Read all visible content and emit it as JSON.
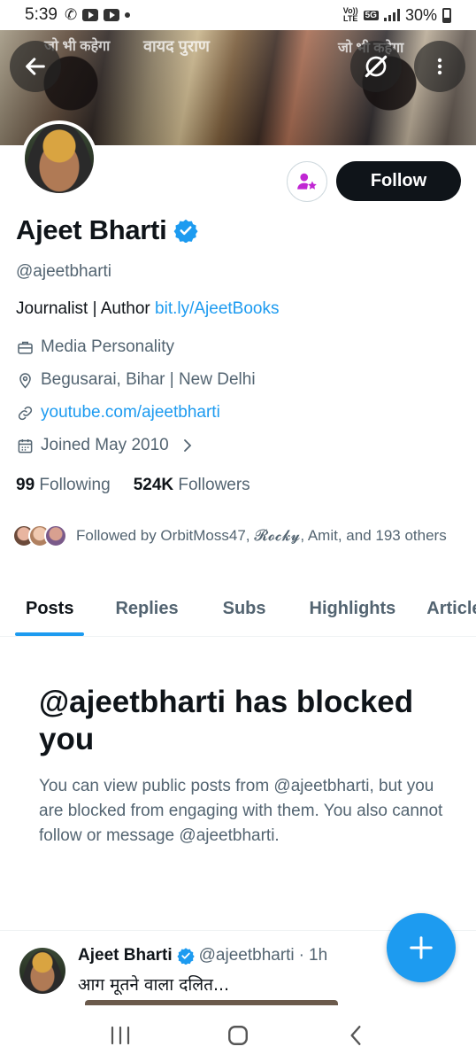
{
  "status_bar": {
    "time": "5:39",
    "volte_top": "Vo))",
    "volte_bottom": "LTE",
    "network": "5G",
    "battery": "30%"
  },
  "banner": {
    "text_left": "जो भी कहेगा",
    "text_mid": "वायद पुराण",
    "text_right": "जो भी कहेगा"
  },
  "profile": {
    "name": "Ajeet Bharti",
    "handle": "@ajeetbharti",
    "bio_text": "Journalist | Author ",
    "bio_link": "bit.ly/AjeetBooks",
    "category": "Media Personality",
    "location": "Begusarai, Bihar | New Delhi",
    "website": "youtube.com/ajeetbharti",
    "joined": "Joined May 2010",
    "following_count": "99",
    "following_label": " Following",
    "followers_count": "524K",
    "followers_label": " Followers",
    "followed_by": "Followed by OrbitMoss47, 𝓡𝓸𝓬𝓴𝔂, Amit, and 193 others",
    "follow_label": "Follow"
  },
  "tabs": [
    {
      "label": "Posts",
      "active": true
    },
    {
      "label": "Replies"
    },
    {
      "label": "Subs"
    },
    {
      "label": "Highlights"
    },
    {
      "label": "Articles"
    }
  ],
  "blocked": {
    "title": "@ajeetbharti has blocked you",
    "body": "You can view public posts from @ajeetbharti, but you are blocked from engaging with them. You also cannot follow or message @ajeetbharti."
  },
  "tweet": {
    "name": "Ajeet Bharti",
    "handle": "@ajeetbharti",
    "separator": "·",
    "time": "1h",
    "text": "आग मूतने वाला दलित..."
  },
  "colors": {
    "accent": "#1d9bf0",
    "text": "#0f1419",
    "muted": "#536471",
    "subscribe_purple": "#c026d3"
  },
  "icons": {
    "back": "back-arrow-icon",
    "grok": "grok-icon",
    "more": "more-vertical-icon",
    "subscribe": "subscribe-star-icon",
    "verified": "verified-badge-icon",
    "briefcase": "briefcase-icon",
    "location": "location-pin-icon",
    "link": "link-icon",
    "calendar": "calendar-icon",
    "compose": "plus-icon"
  }
}
